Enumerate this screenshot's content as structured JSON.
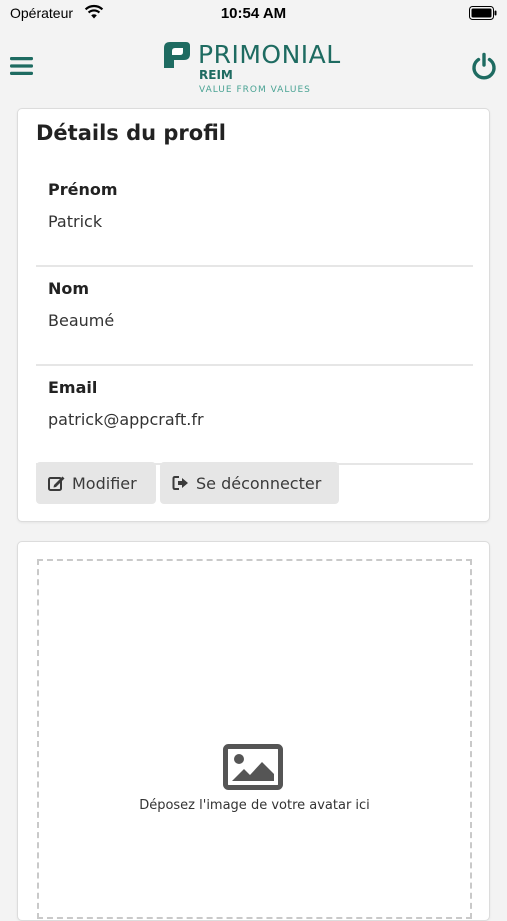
{
  "status_bar": {
    "carrier": "Opérateur",
    "time": "10:54 AM",
    "wifi_icon": "wifi-icon",
    "battery_icon": "battery-icon"
  },
  "header": {
    "menu_icon": "hamburger-menu-icon",
    "power_icon": "power-icon",
    "logo": {
      "brand": "PRIMONIAL",
      "sub": "REIM",
      "tagline": "VALUE FROM VALUES"
    }
  },
  "profile": {
    "title": "Détails du profil",
    "fields": [
      {
        "label": "Prénom",
        "value": "Patrick"
      },
      {
        "label": "Nom",
        "value": "Beaumé"
      },
      {
        "label": "Email",
        "value": "patrick@appcraft.fr"
      }
    ],
    "buttons": {
      "edit_label": "Modifier",
      "logout_label": "Se déconnecter"
    }
  },
  "avatar": {
    "dropzone_text": "Déposez l'image de votre avatar ici",
    "icon": "image-icon"
  },
  "colors": {
    "brand": "#1e6b61",
    "brand_light": "#4aa394",
    "background": "#f3f3f3",
    "button_bg": "#e6e6e6"
  }
}
